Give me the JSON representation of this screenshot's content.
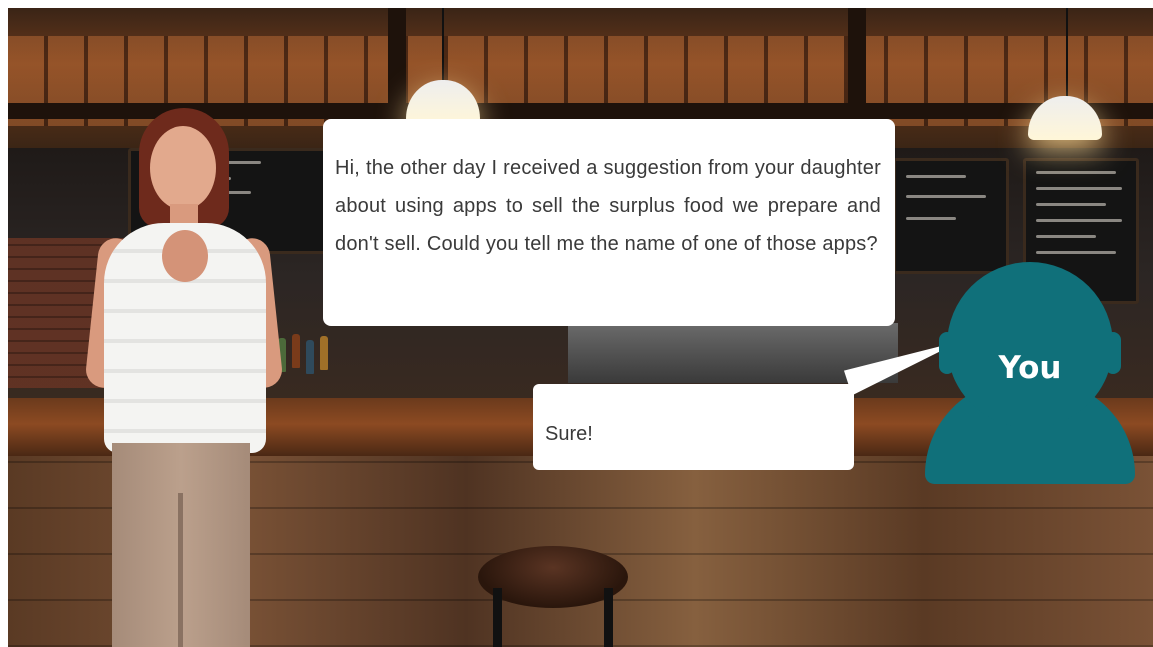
{
  "dialogue": {
    "npc_line": "Hi, the other day I received a suggestion from your daughter about using apps to sell the surplus food we prepare and don't sell. Could you tell me the name of one of those apps?",
    "player_response": "Sure!",
    "player_label": "You"
  },
  "colors": {
    "avatar": "#10707a",
    "bubble": "#ffffff",
    "text": "#3a3a3a"
  }
}
